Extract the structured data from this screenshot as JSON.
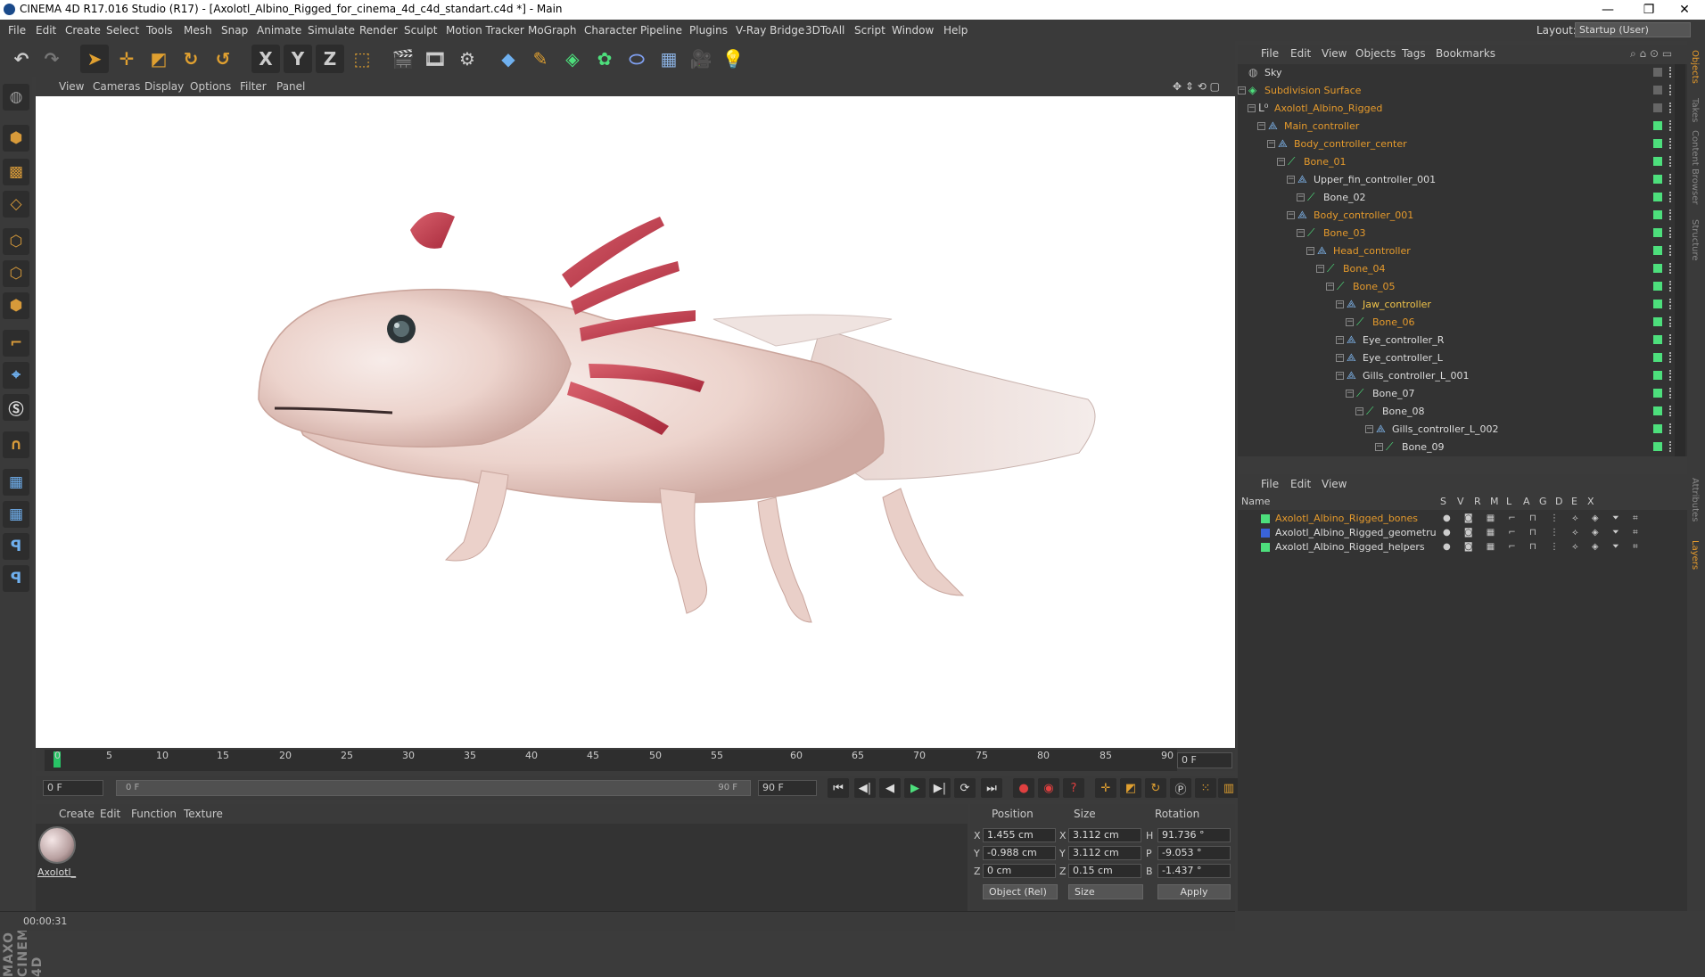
{
  "window": {
    "title": "CINEMA 4D R17.016 Studio (R17) - [Axolotl_Albino_Rigged_for_cinema_4d_c4d_standart.c4d *] - Main",
    "minimize": "—",
    "restore": "❐",
    "close": "✕"
  },
  "menubar": {
    "items": [
      "File",
      "Edit",
      "Create",
      "Select",
      "Tools",
      "Mesh",
      "Snap",
      "Animate",
      "Simulate",
      "Render",
      "Sculpt",
      "Motion Tracker",
      "MoGraph",
      "Character",
      "Pipeline",
      "Plugins",
      "V-Ray Bridge",
      "3DToAll",
      "Script",
      "Window",
      "Help"
    ],
    "layout_label": "Layout:",
    "layout_value": "Startup (User)"
  },
  "toolbar": {
    "undo_icon": "undo-icon",
    "axis_x": "X",
    "axis_y": "Y",
    "axis_z": "Z"
  },
  "viewport": {
    "menu": [
      "View",
      "Cameras",
      "Display",
      "Options",
      "Filter",
      "Panel"
    ]
  },
  "timeline": {
    "ticks": [
      "0",
      "5",
      "10",
      "15",
      "20",
      "25",
      "30",
      "35",
      "40",
      "45",
      "50",
      "55",
      "60",
      "65",
      "70",
      "75",
      "80",
      "85",
      "90"
    ],
    "current_frame": "0 F",
    "start_field": "0 F",
    "slider_start": "0 F",
    "slider_end": "90 F",
    "end_field": "90 F"
  },
  "materials": {
    "menu": [
      "Create",
      "Edit",
      "Function",
      "Texture"
    ],
    "items": [
      {
        "label": "Axolotl_"
      }
    ]
  },
  "coordinates": {
    "headers": {
      "position": "Position",
      "size": "Size",
      "rotation": "Rotation"
    },
    "rows": [
      {
        "pos_axis": "X",
        "pos": "1.455 cm",
        "size_axis": "X",
        "size": "3.112 cm",
        "rot_axis": "H",
        "rot": "91.736 °"
      },
      {
        "pos_axis": "Y",
        "pos": "-0.988 cm",
        "size_axis": "Y",
        "size": "3.112 cm",
        "rot_axis": "P",
        "rot": "-9.053 °"
      },
      {
        "pos_axis": "Z",
        "pos": "0 cm",
        "size_axis": "Z",
        "size": "0.15 cm",
        "rot_axis": "B",
        "rot": "-1.437 °"
      }
    ],
    "mode": "Object (Rel)",
    "size_mode": "Size",
    "apply": "Apply"
  },
  "status": {
    "time": "00:00:31"
  },
  "objects": {
    "menu": [
      "File",
      "Edit",
      "View",
      "Objects",
      "Tags",
      "Bookmarks"
    ],
    "tree": [
      {
        "name": "Sky",
        "depth": 0,
        "color": "white",
        "icon": "sky-icon",
        "tag": "gray"
      },
      {
        "name": "Subdivision Surface",
        "depth": 0,
        "color": "orange",
        "icon": "subdivision-icon",
        "tag": "gray"
      },
      {
        "name": "Axolotl_Albino_Rigged",
        "depth": 1,
        "color": "orange",
        "icon": "null-icon",
        "tag": "gray"
      },
      {
        "name": "Main_controller",
        "depth": 2,
        "color": "orange",
        "icon": "controller-icon",
        "tag": "green"
      },
      {
        "name": "Body_controller_center",
        "depth": 3,
        "color": "orange",
        "icon": "controller-icon",
        "tag": "green"
      },
      {
        "name": "Bone_01",
        "depth": 4,
        "color": "orange",
        "icon": "bone-icon",
        "tag": "green"
      },
      {
        "name": "Upper_fin_controller_001",
        "depth": 5,
        "color": "white",
        "icon": "controller-icon",
        "tag": "green"
      },
      {
        "name": "Bone_02",
        "depth": 6,
        "color": "white",
        "icon": "bone-icon",
        "tag": "green"
      },
      {
        "name": "Body_controller_001",
        "depth": 5,
        "color": "orange",
        "icon": "controller-icon",
        "tag": "green"
      },
      {
        "name": "Bone_03",
        "depth": 6,
        "color": "orange",
        "icon": "bone-icon",
        "tag": "green"
      },
      {
        "name": "Head_controller",
        "depth": 7,
        "color": "orange",
        "icon": "controller-icon",
        "tag": "green"
      },
      {
        "name": "Bone_04",
        "depth": 8,
        "color": "orange",
        "icon": "bone-icon",
        "tag": "green"
      },
      {
        "name": "Bone_05",
        "depth": 9,
        "color": "orange",
        "icon": "bone-icon",
        "tag": "green"
      },
      {
        "name": "Jaw_controller",
        "depth": 10,
        "color": "yellow",
        "icon": "controller-icon",
        "tag": "green"
      },
      {
        "name": "Bone_06",
        "depth": 11,
        "color": "orange",
        "icon": "bone-icon",
        "tag": "green"
      },
      {
        "name": "Eye_controller_R",
        "depth": 10,
        "color": "white",
        "icon": "controller-icon",
        "tag": "green"
      },
      {
        "name": "Eye_controller_L",
        "depth": 10,
        "color": "white",
        "icon": "controller-icon",
        "tag": "green"
      },
      {
        "name": "Gills_controller_L_001",
        "depth": 10,
        "color": "white",
        "icon": "controller-icon",
        "tag": "green"
      },
      {
        "name": "Bone_07",
        "depth": 11,
        "color": "white",
        "icon": "bone-icon",
        "tag": "green"
      },
      {
        "name": "Bone_08",
        "depth": 12,
        "color": "white",
        "icon": "bone-icon",
        "tag": "green"
      },
      {
        "name": "Gills_controller_L_002",
        "depth": 13,
        "color": "white",
        "icon": "controller-icon",
        "tag": "green"
      },
      {
        "name": "Bone_09",
        "depth": 14,
        "color": "white",
        "icon": "bone-icon",
        "tag": "green"
      }
    ]
  },
  "layers": {
    "menu": [
      "File",
      "Edit",
      "View"
    ],
    "header": {
      "name": "Name",
      "flags": [
        "S",
        "V",
        "R",
        "M",
        "L",
        "A",
        "G",
        "D",
        "E",
        "X"
      ]
    },
    "items": [
      {
        "name": "Axolotl_Albino_Rigged_bones",
        "color": "#4ddf7c",
        "text": "orange"
      },
      {
        "name": "Axolotl_Albino_Rigged_geometru",
        "color": "#3a63d8",
        "text": "white"
      },
      {
        "name": "Axolotl_Albino_Rigged_helpers",
        "color": "#4ddf7c",
        "text": "white"
      }
    ]
  },
  "side_tabs": [
    "Objects",
    "Takes",
    "Content Browser",
    "Structure",
    "Attributes",
    "Layers"
  ]
}
